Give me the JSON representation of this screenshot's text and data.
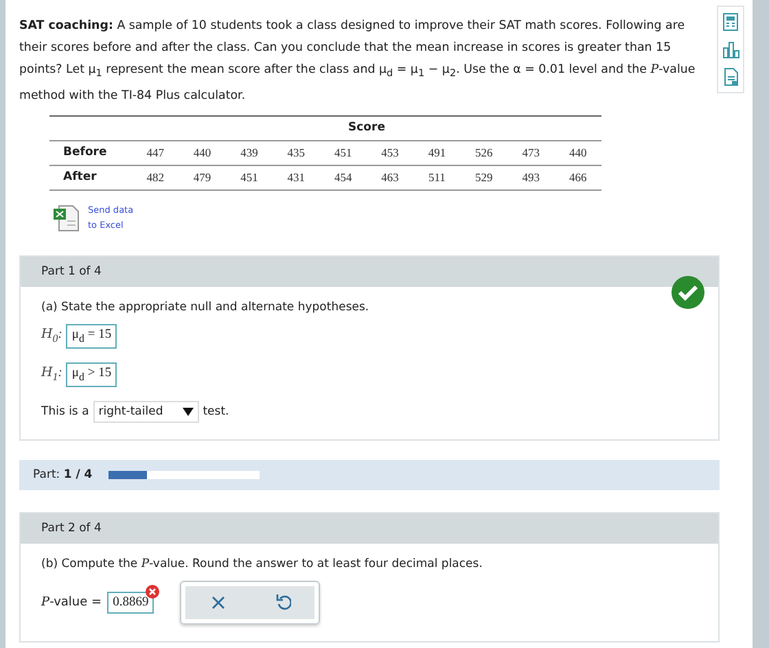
{
  "problem": {
    "text": "**SAT coaching:** A sample of 10 students took a class designed to improve their SAT math scores. Following are their scores before and after the class. Can you conclude that the mean increase in scores is greater than 15 points? Let μ$_{1}$ represent the mean score after the class and μ$_{d}$ = μ$_{1}$ − μ$_{2}$. Use the α = 0.01 level and the *P*-value method with the TI-84 Plus calculator."
  },
  "table": {
    "header": "Score",
    "rows": [
      {
        "label": "Before",
        "values": [
          "447",
          "440",
          "439",
          "435",
          "451",
          "453",
          "491",
          "526",
          "473",
          "440"
        ]
      },
      {
        "label": "After",
        "values": [
          "482",
          "479",
          "451",
          "431",
          "454",
          "463",
          "511",
          "529",
          "493",
          "466"
        ]
      }
    ]
  },
  "excel_link": {
    "text": "Send data to Excel"
  },
  "part1": {
    "title": "Part 1 of 4",
    "correct": true,
    "prompt": "(a) State the appropriate null and alternate hypotheses.",
    "hypotheses": [
      {
        "label": "*H*$_{0}$:",
        "value": "μ$_{d}$ = 15"
      },
      {
        "label": "*H*$_{1}$:",
        "value": "μ$_{d}$ > 15"
      }
    ],
    "tail_before": "This is a",
    "tail_select": "right-tailed",
    "tail_after": "test."
  },
  "progress": {
    "label": "Part:",
    "value": "1 / 4",
    "level": 0.25
  },
  "part2": {
    "title": "Part 2 of 4",
    "prompt": "(b) Compute the *P*-value. Round the answer to at least four decimal places.",
    "answer_label": "*P*-value =",
    "answer_value": "0.8869",
    "error": true
  }
}
